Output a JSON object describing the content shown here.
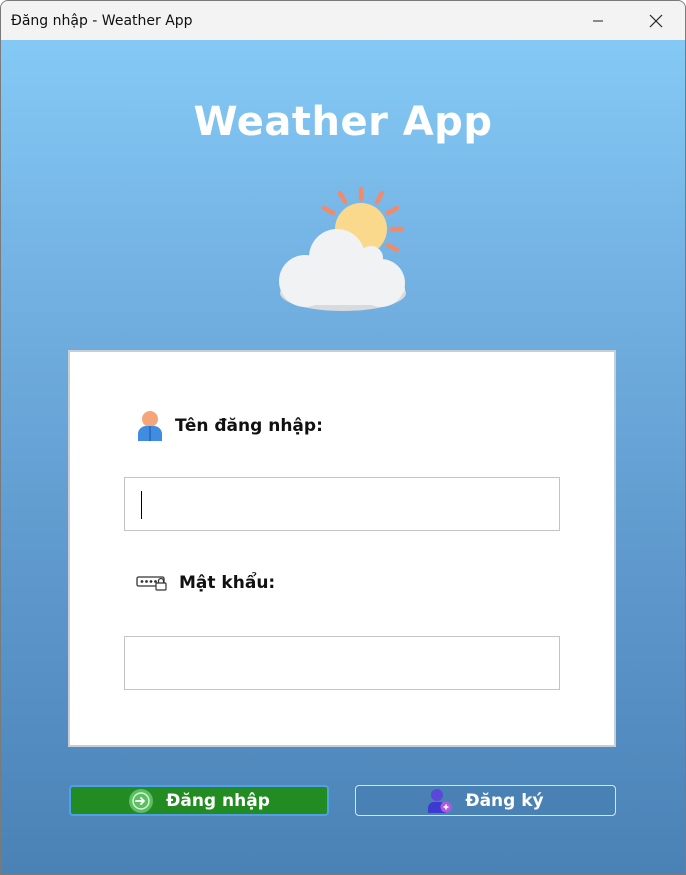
{
  "window": {
    "title": "Đăng nhập - Weather App",
    "controls": {
      "minimize": "minimize-icon",
      "close": "close-icon"
    }
  },
  "header": {
    "app_title": "Weather App",
    "icon": "sun-behind-cloud-icon"
  },
  "form": {
    "username": {
      "label": "Tên đăng nhập:",
      "icon": "user-icon",
      "value": ""
    },
    "password": {
      "label": "Mật khẩu:",
      "icon": "password-icon",
      "value": ""
    }
  },
  "actions": {
    "login": {
      "label": "Đăng nhập",
      "icon": "login-icon",
      "color": "#228b22"
    },
    "register": {
      "label": "Đăng ký",
      "icon": "add-user-icon",
      "color": "#4a81b5"
    }
  },
  "colors": {
    "background_top": "#87cdf8",
    "background_bottom": "#4a82b6"
  }
}
